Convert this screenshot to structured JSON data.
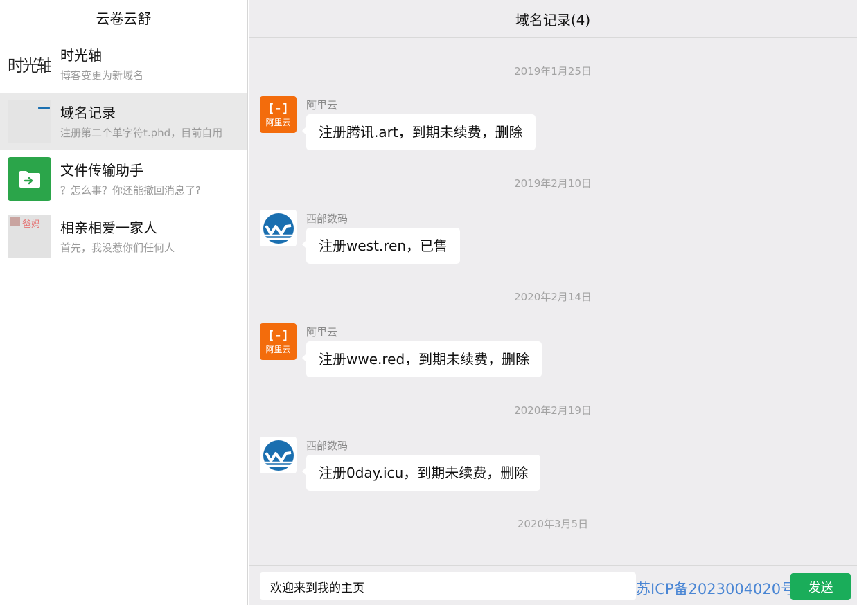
{
  "sidebar": {
    "title": "云卷云舒",
    "conversations": [
      {
        "title": "时光轴",
        "preview": "博客变更为新域名",
        "avatar_text": "时光轴"
      },
      {
        "title": "域名记录",
        "preview": "注册第二个单字符t.phd，目前自用"
      },
      {
        "title": "文件传输助手",
        "preview": "？怎么事？你还能撤回消息了?"
      },
      {
        "title": "相亲相爱一家人",
        "preview": "首先，我没惹你们任何人",
        "avatar_text": "爸妈"
      }
    ]
  },
  "chat": {
    "title": "域名记录(4)",
    "messages": [
      {
        "date": "2019年1月25日",
        "sender": "阿里云",
        "logo": "aliyun",
        "text": "注册腾讯.art，到期未续费，删除"
      },
      {
        "date": "2019年2月10日",
        "sender": "西部数码",
        "logo": "west",
        "text": "注册west.ren，已售"
      },
      {
        "date": "2020年2月14日",
        "sender": "阿里云",
        "logo": "aliyun",
        "text": "注册wwe.red，到期未续费，删除"
      },
      {
        "date": "2020年2月19日",
        "sender": "西部数码",
        "logo": "west",
        "text": "注册0day.icu，到期未续费，删除"
      }
    ],
    "trailing_date": "2020年3月5日"
  },
  "logos": {
    "aliyun_mark": "[-]",
    "aliyun_text": "阿里云"
  },
  "footer": {
    "input_value": "欢迎来到我的主页",
    "icp": "苏ICP备2023004020号",
    "send_label": "发送"
  },
  "colors": {
    "aliyun_orange": "#f36c0c",
    "west_blue": "#1a6fb0",
    "send_green": "#1aad5a",
    "link_blue": "#4a86d4",
    "folder_green": "#2ba54a"
  }
}
